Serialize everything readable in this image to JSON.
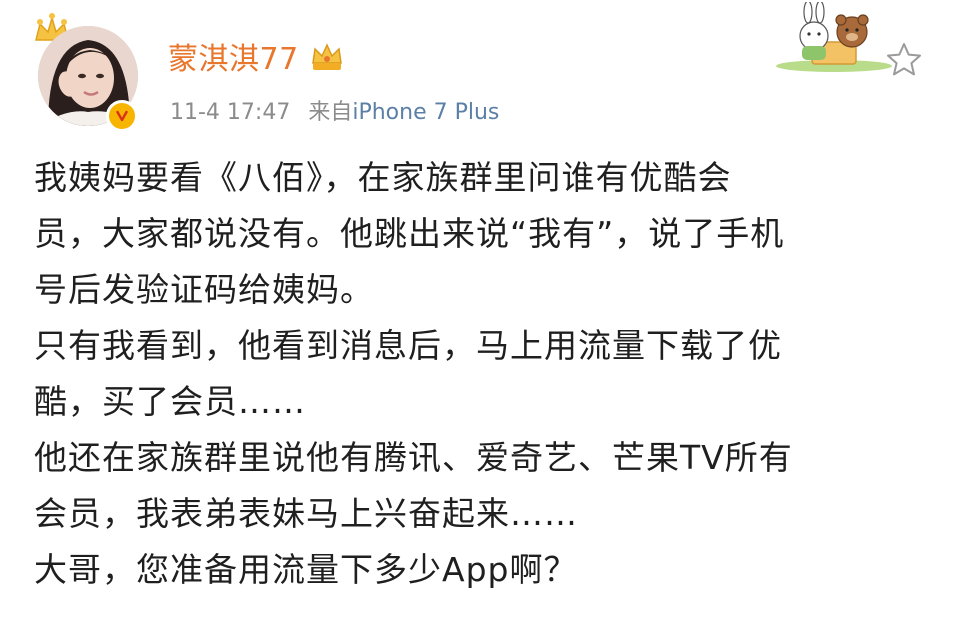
{
  "user": {
    "name": "蒙淇淇77",
    "avatar_icon": "avatar-photo",
    "verified_icon": "v-verified-badge",
    "vip_icon": "vip-crown-badge",
    "accent_color": "#e8762d"
  },
  "meta": {
    "time": "11-4 17:47",
    "source_prefix": "来自",
    "device": "iPhone 7 Plus"
  },
  "actions": {
    "favorite_icon": "star-outline-icon"
  },
  "post": {
    "lines": [
      "我姨妈要看《八佰》，在家族群里问谁有优酷会",
      "员，大家都说没有。他跳出来说“我有”，说了手机",
      "号后发验证码给姨妈。",
      "只有我看到，他看到消息后，马上用流量下载了优",
      "酷，买了会员……",
      "他还在家族群里说他有腾讯、爱奇艺、芒果TV所有",
      "会员，我表弟表妹马上兴奋起来……",
      "大哥，您准备用流量下多少App啊？"
    ]
  }
}
